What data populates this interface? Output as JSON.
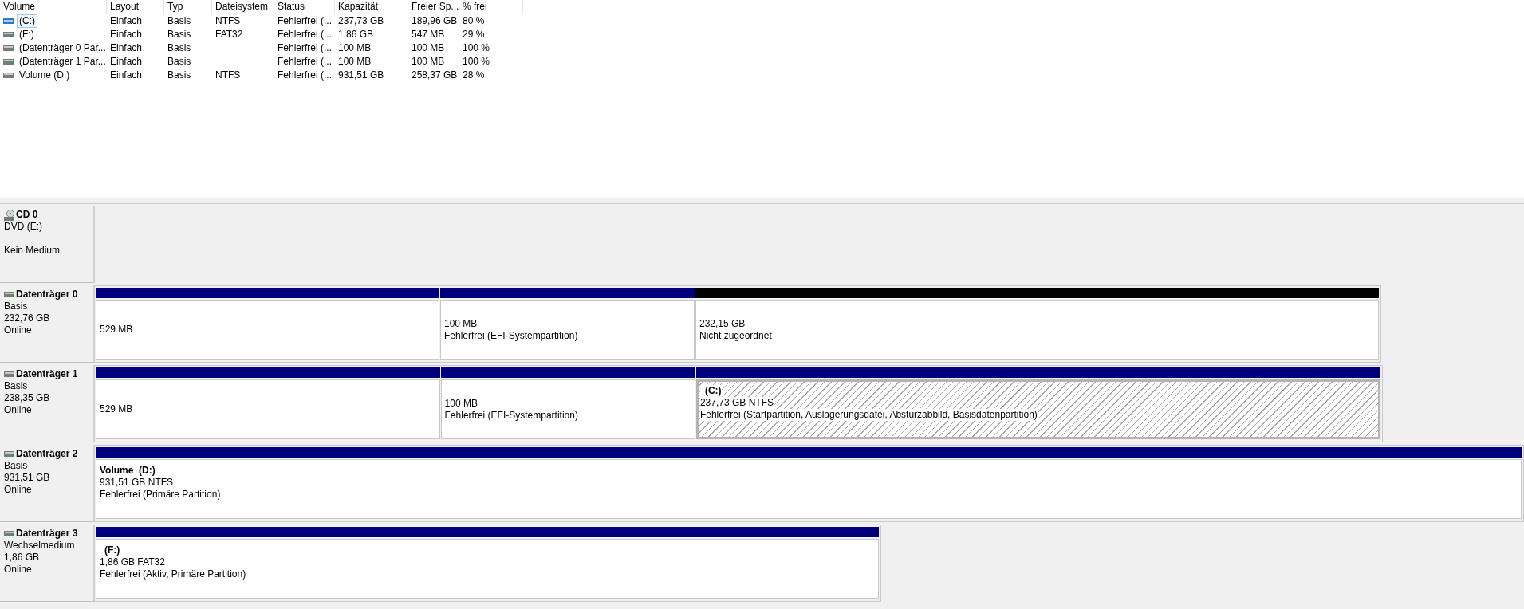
{
  "volume_table": {
    "columns": [
      "Volume",
      "Layout",
      "Typ",
      "Dateisystem",
      "Status",
      "Kapazität",
      "Freier Sp...",
      "% frei"
    ],
    "rows": [
      {
        "kind": "system",
        "volume": "(C:)",
        "layout": "Einfach",
        "type": "Basis",
        "filesystem": "NTFS",
        "status": "Fehlerfrei (...",
        "capacity": "237,73 GB",
        "free": "189,96 GB",
        "percent_free": "80 %",
        "selected": true
      },
      {
        "kind": "drive",
        "volume": "(F:)",
        "layout": "Einfach",
        "type": "Basis",
        "filesystem": "FAT32",
        "status": "Fehlerfrei (...",
        "capacity": "1,86 GB",
        "free": "547 MB",
        "percent_free": "29 %",
        "selected": false
      },
      {
        "kind": "drive",
        "volume": "(Datenträger 0 Par...",
        "layout": "Einfach",
        "type": "Basis",
        "status": "Fehlerfrei (...",
        "capacity": "100 MB",
        "free": "100 MB",
        "percent_free": "100 %",
        "selected": false
      },
      {
        "kind": "drive",
        "volume": "(Datenträger 1 Par...",
        "layout": "Einfach",
        "type": "Basis",
        "status": "Fehlerfrei (...",
        "capacity": "100 MB",
        "free": "100 MB",
        "percent_free": "100 %",
        "selected": false
      },
      {
        "kind": "drive",
        "volume": "Volume (D:)",
        "layout": "Einfach",
        "type": "Basis",
        "filesystem": "NTFS",
        "status": "Fehlerfrei (...",
        "capacity": "931,51 GB",
        "free": "258,37 GB",
        "percent_free": "28 %",
        "selected": false
      }
    ]
  },
  "disks": [
    {
      "kind": "cd",
      "name": "CD 0",
      "details": [
        "DVD (E:)",
        "Kein Medium"
      ]
    },
    {
      "kind": "disk",
      "name": "Datenträger 0",
      "details": [
        "Basis",
        "232,76 GB",
        "Online"
      ],
      "partitions": [
        {
          "kind": "primary",
          "lines": [
            "529 MB"
          ],
          "selected": false
        },
        {
          "kind": "primary",
          "lines": [
            "100 MB",
            "Fehlerfrei (EFI-Systempartition)"
          ],
          "selected": false
        },
        {
          "kind": "unallocated",
          "lines": [
            "232,15 GB",
            "Nicht zugeordnet"
          ],
          "selected": false
        }
      ]
    },
    {
      "kind": "disk",
      "name": "Datenträger 1",
      "details": [
        "Basis",
        "238,35 GB",
        "Online"
      ],
      "partitions": [
        {
          "kind": "primary",
          "lines": [
            "529 MB"
          ],
          "selected": false
        },
        {
          "kind": "primary",
          "lines": [
            "100 MB",
            "Fehlerfrei (EFI-Systempartition)"
          ],
          "selected": false
        },
        {
          "kind": "primary",
          "name": "(C:)",
          "lines": [
            "237,73 GB NTFS",
            "Fehlerfrei (Startpartition, Auslagerungsdatei, Absturzabbild, Basisdatenpartition)"
          ],
          "selected": true
        }
      ]
    },
    {
      "kind": "disk",
      "name": "Datenträger 2",
      "details": [
        "Basis",
        "931,51 GB",
        "Online"
      ],
      "partitions": [
        {
          "kind": "primary",
          "name": "Volume  (D:)",
          "lines": [
            "931,51 GB NTFS",
            "Fehlerfrei (Primäre Partition)"
          ],
          "selected": false
        }
      ]
    },
    {
      "kind": "disk",
      "name": "Datenträger 3",
      "details": [
        "Wechselmedium",
        "1,86 GB",
        "Online"
      ],
      "partitions": [
        {
          "kind": "primary",
          "name": "(F:)",
          "lines": [
            "1,86 GB FAT32",
            "Fehlerfrei (Aktiv, Primäre Partition)"
          ],
          "selected": false
        }
      ]
    }
  ]
}
